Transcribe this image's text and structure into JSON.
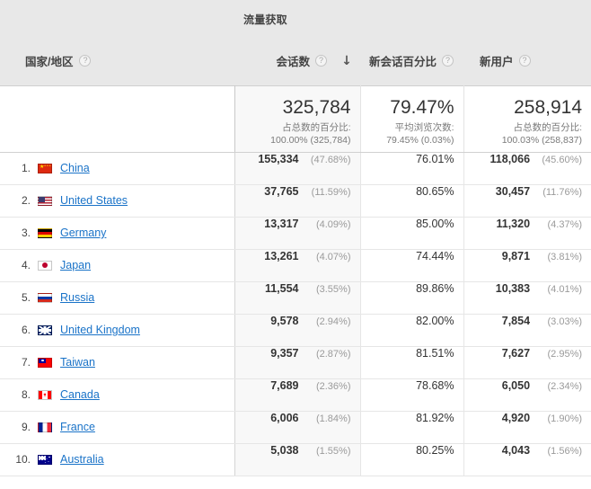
{
  "table": {
    "dimension_header": {
      "label": "国家/地区",
      "help_icon": "help-question-icon"
    },
    "group_header": {
      "label": "流量获取"
    },
    "metrics": [
      {
        "label": "会话数",
        "help_icon": "help-question-icon",
        "sorted": true,
        "sort_icon": "arrow-down-icon"
      },
      {
        "label": "新会话百分比",
        "help_icon": "help-question-icon",
        "sorted": false
      },
      {
        "label": "新用户",
        "help_icon": "help-question-icon",
        "sorted": false
      }
    ],
    "summary": [
      {
        "value": "325,784",
        "label": "占总数的百分比:",
        "sub": "100.00% (325,784)"
      },
      {
        "value": "79.47%",
        "label": "平均浏览次数:",
        "sub": "79.45% (0.03%)"
      },
      {
        "value": "258,914",
        "label": "占总数的百分比:",
        "sub": "100.03% (258,837)"
      }
    ],
    "rows": [
      {
        "rank": "1.",
        "flag": "flag-china",
        "flag_class": "f-cn",
        "country": "China",
        "sessions": "155,334",
        "sessions_pct": "(47.68%)",
        "new_session_pct": "76.01%",
        "new_users": "118,066",
        "new_users_pct": "(45.60%)"
      },
      {
        "rank": "2.",
        "flag": "flag-united-states",
        "flag_class": "f-us",
        "country": "United States",
        "sessions": "37,765",
        "sessions_pct": "(11.59%)",
        "new_session_pct": "80.65%",
        "new_users": "30,457",
        "new_users_pct": "(11.76%)"
      },
      {
        "rank": "3.",
        "flag": "flag-germany",
        "flag_class": "f-de",
        "country": "Germany",
        "sessions": "13,317",
        "sessions_pct": "(4.09%)",
        "new_session_pct": "85.00%",
        "new_users": "11,320",
        "new_users_pct": "(4.37%)"
      },
      {
        "rank": "4.",
        "flag": "flag-japan",
        "flag_class": "f-jp",
        "country": "Japan",
        "sessions": "13,261",
        "sessions_pct": "(4.07%)",
        "new_session_pct": "74.44%",
        "new_users": "9,871",
        "new_users_pct": "(3.81%)"
      },
      {
        "rank": "5.",
        "flag": "flag-russia",
        "flag_class": "f-ru",
        "country": "Russia",
        "sessions": "11,554",
        "sessions_pct": "(3.55%)",
        "new_session_pct": "89.86%",
        "new_users": "10,383",
        "new_users_pct": "(4.01%)"
      },
      {
        "rank": "6.",
        "flag": "flag-united-kingdom",
        "flag_class": "f-gb",
        "country": "United Kingdom",
        "sessions": "9,578",
        "sessions_pct": "(2.94%)",
        "new_session_pct": "82.00%",
        "new_users": "7,854",
        "new_users_pct": "(3.03%)"
      },
      {
        "rank": "7.",
        "flag": "flag-taiwan",
        "flag_class": "f-tw",
        "country": "Taiwan",
        "sessions": "9,357",
        "sessions_pct": "(2.87%)",
        "new_session_pct": "81.51%",
        "new_users": "7,627",
        "new_users_pct": "(2.95%)"
      },
      {
        "rank": "8.",
        "flag": "flag-canada",
        "flag_class": "f-ca",
        "country": "Canada",
        "sessions": "7,689",
        "sessions_pct": "(2.36%)",
        "new_session_pct": "78.68%",
        "new_users": "6,050",
        "new_users_pct": "(2.34%)"
      },
      {
        "rank": "9.",
        "flag": "flag-france",
        "flag_class": "f-fr",
        "country": "France",
        "sessions": "6,006",
        "sessions_pct": "(1.84%)",
        "new_session_pct": "81.92%",
        "new_users": "4,920",
        "new_users_pct": "(1.90%)"
      },
      {
        "rank": "10.",
        "flag": "flag-australia",
        "flag_class": "f-au",
        "country": "Australia",
        "sessions": "5,038",
        "sessions_pct": "(1.55%)",
        "new_session_pct": "80.25%",
        "new_users": "4,043",
        "new_users_pct": "(1.56%)"
      }
    ]
  },
  "colors": {
    "link": "#1a73c8",
    "header_bg": "#e8e8e8",
    "tint_column": "#f8f8f8",
    "text": "#333333",
    "muted": "#9a9a9a"
  },
  "help_glyph": "?",
  "sort_glyph": "↓"
}
